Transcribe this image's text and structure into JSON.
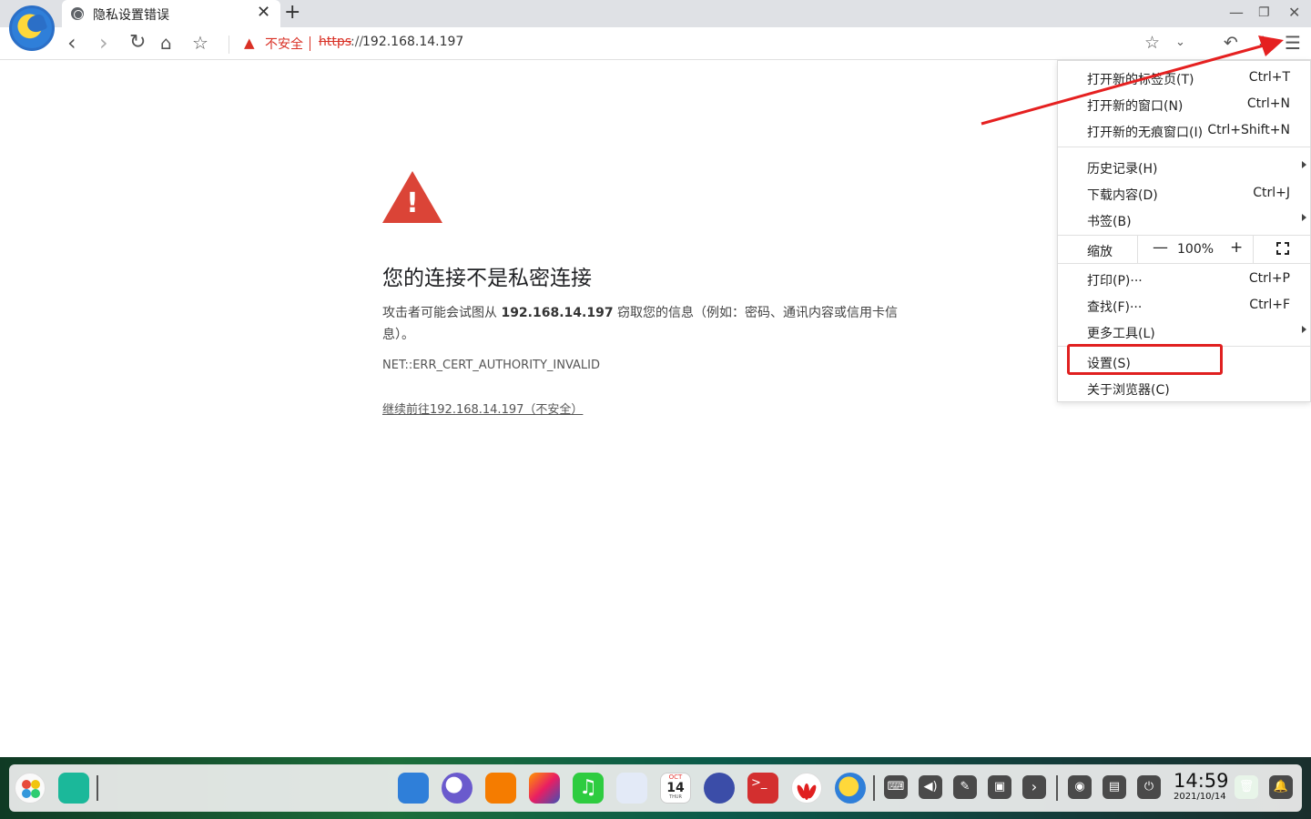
{
  "browser": {
    "tab_title": "隐私设置错误",
    "tab_close": "✕",
    "new_tab": "+",
    "window_controls": {
      "minimize": "—",
      "restore": "❐",
      "close": "✕"
    },
    "security_label": "不安全",
    "url_scheme": "https",
    "url_separator": "://",
    "url_host": "192.168.14.197"
  },
  "toolbar_icons": [
    "back-icon",
    "forward-icon",
    "reload-icon",
    "home-icon",
    "star-icon",
    "bookmark-star-icon",
    "dropdown-icon",
    "undo-icon",
    "download-icon",
    "menu-icon"
  ],
  "error_page": {
    "title": "您的连接不是私密连接",
    "desc_before": "攻击者可能会试图从",
    "desc_host": "192.168.14.197",
    "desc_after": "窃取您的信息（例如：密码、通讯内容或信用卡信息）。",
    "error_code": "NET::ERR_CERT_AUTHORITY_INVALID",
    "proceed_link": "继续前往192.168.14.197（不安全）"
  },
  "menu": {
    "groups": [
      [
        {
          "label": "打开新的标签页(T)",
          "shortcut": "Ctrl+T"
        },
        {
          "label": "打开新的窗口(N)",
          "shortcut": "Ctrl+N"
        },
        {
          "label": "打开新的无痕窗口(I)",
          "shortcut": "Ctrl+Shift+N"
        }
      ],
      [
        {
          "label": "历史记录(H)",
          "shortcut": ""
        },
        {
          "label": "下载内容(D)",
          "shortcut": "Ctrl+J"
        },
        {
          "label": "书签(B)",
          "shortcut": ""
        }
      ],
      [
        {
          "label": "打印(P)···",
          "shortcut": "Ctrl+P"
        },
        {
          "label": "查找(F)···",
          "shortcut": "Ctrl+F"
        },
        {
          "label": "更多工具(L)",
          "shortcut": ""
        }
      ],
      [
        {
          "label": "设置(S)",
          "shortcut": ""
        },
        {
          "label": "关于浏览器(C)",
          "shortcut": ""
        }
      ]
    ],
    "zoom": {
      "label": "缩放",
      "minus": "—",
      "value": "100%",
      "plus": "+"
    }
  },
  "taskbar": {
    "time": "14:59",
    "date": "2021/10/14",
    "calendar_month": "OCT",
    "calendar_day": "14",
    "calendar_weekday": "THUR",
    "terminal_glyph": ">_",
    "tray_glyphs": [
      "⌨",
      "◀)",
      "✎",
      "▣",
      "›",
      "◉",
      "▤",
      "⏻",
      "🗑",
      "🔔"
    ]
  },
  "colors": {
    "danger": "#d93025",
    "warning_triangle": "#db4437",
    "highlight_box": "#e02020"
  }
}
